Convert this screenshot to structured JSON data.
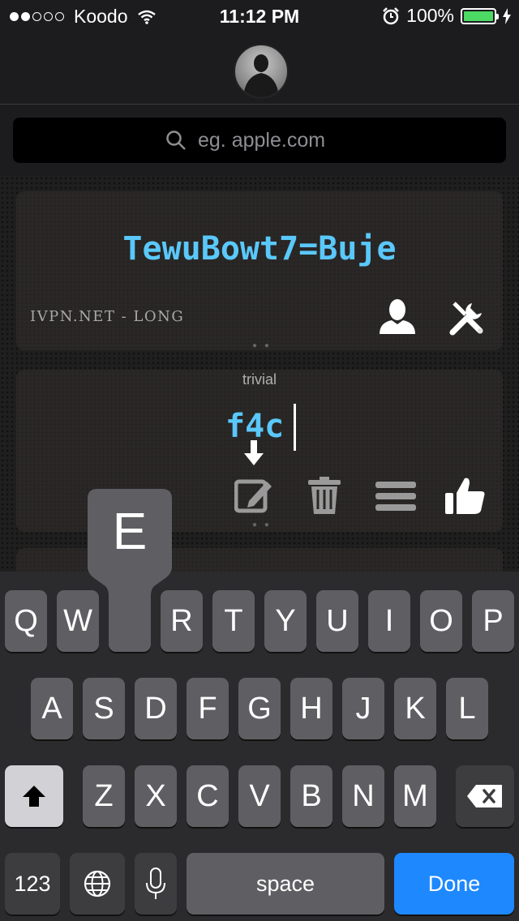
{
  "status_bar": {
    "carrier": "Koodo",
    "signal_dots_filled": 2,
    "signal_dots_total": 5,
    "time": "11:12 PM",
    "battery": "100%",
    "battery_color": "#4cd964"
  },
  "search": {
    "placeholder": "eg. apple.com"
  },
  "cards": [
    {
      "password": "TewuBowt7=Buje",
      "site_label": "IVPN.NET - LONG"
    },
    {
      "strength_label": "trivial",
      "password_input": "f4c"
    }
  ],
  "keyboard": {
    "row1": [
      "Q",
      "W",
      "E",
      "R",
      "T",
      "Y",
      "U",
      "I",
      "O",
      "P"
    ],
    "row2": [
      "A",
      "S",
      "D",
      "F",
      "G",
      "H",
      "J",
      "K",
      "L"
    ],
    "row3": [
      "Z",
      "X",
      "C",
      "V",
      "B",
      "N",
      "M"
    ],
    "numbers_label": "123",
    "space_label": "space",
    "done_label": "Done",
    "popup_key": "E"
  },
  "colors": {
    "accent": "#5ac8fa",
    "done_button": "#1e88ff"
  },
  "icons": [
    "wifi-icon",
    "alarm-icon",
    "charging-icon",
    "search-icon",
    "user-icon",
    "tools-icon",
    "edit-icon",
    "trash-icon",
    "menu-icon",
    "thumbs-up-icon",
    "shift-icon",
    "delete-icon",
    "globe-icon",
    "mic-icon",
    "down-arrow-icon"
  ]
}
